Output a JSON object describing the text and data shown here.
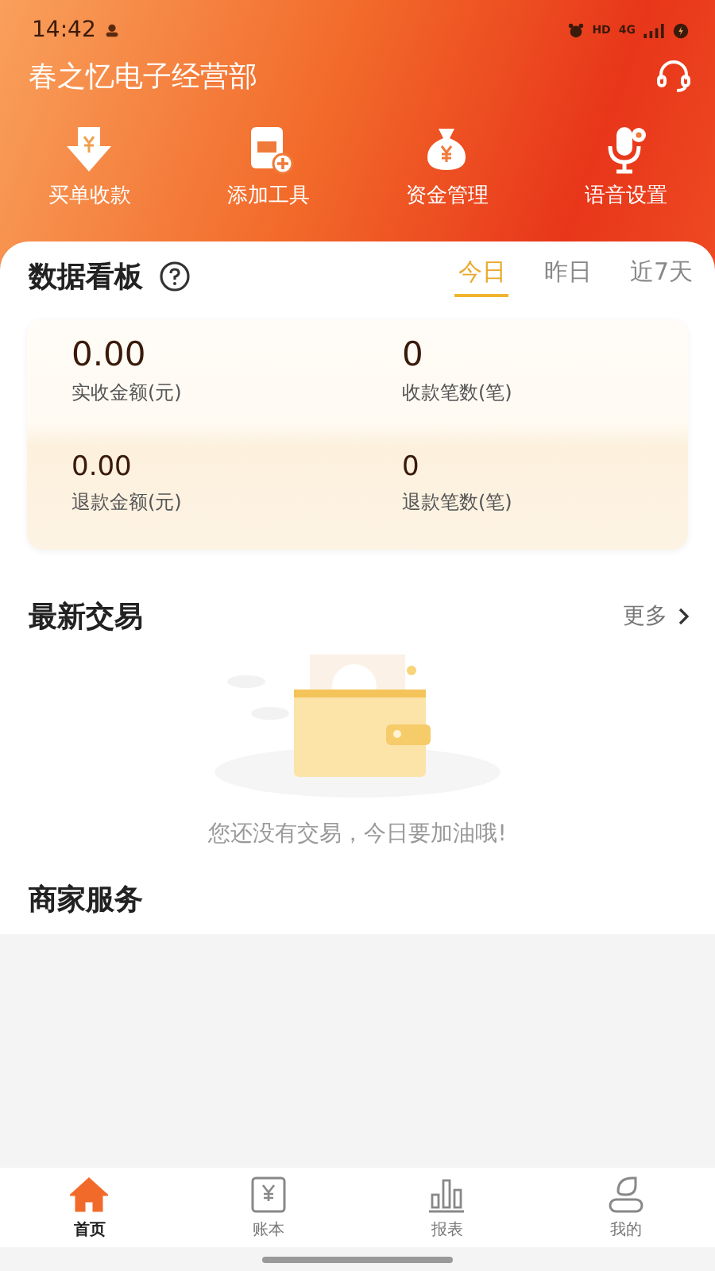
{
  "status_bar": {
    "time": "14:42",
    "hd": "HD",
    "network": "4G"
  },
  "header": {
    "title": "春之忆电子经营部"
  },
  "actions": [
    {
      "kind": "receive",
      "label": "买单收款"
    },
    {
      "kind": "tool",
      "label": "添加工具"
    },
    {
      "kind": "money",
      "label": "资金管理"
    },
    {
      "kind": "voice",
      "label": "语音设置"
    }
  ],
  "dashboard": {
    "title": "数据看板",
    "tabs": [
      {
        "label": "今日",
        "selected": true
      },
      {
        "label": "昨日",
        "selected": false
      },
      {
        "label": "近7天",
        "selected": false
      }
    ],
    "stats": [
      {
        "value": "0.00",
        "label": "实收金额(元)"
      },
      {
        "value": "0",
        "label": "收款笔数(笔)"
      },
      {
        "value": "0.00",
        "label": "退款金额(元)"
      },
      {
        "value": "0",
        "label": "退款笔数(笔)"
      }
    ]
  },
  "transactions": {
    "title": "最新交易",
    "more": "更多",
    "empty_message": "您还没有交易，今日要加油哦!"
  },
  "services": {
    "title": "商家服务"
  },
  "bottom_nav": [
    {
      "kind": "home",
      "label": "首页",
      "selected": true
    },
    {
      "kind": "ledger",
      "label": "账本",
      "selected": false
    },
    {
      "kind": "report",
      "label": "报表",
      "selected": false
    },
    {
      "kind": "profile",
      "label": "我的",
      "selected": false
    }
  ]
}
